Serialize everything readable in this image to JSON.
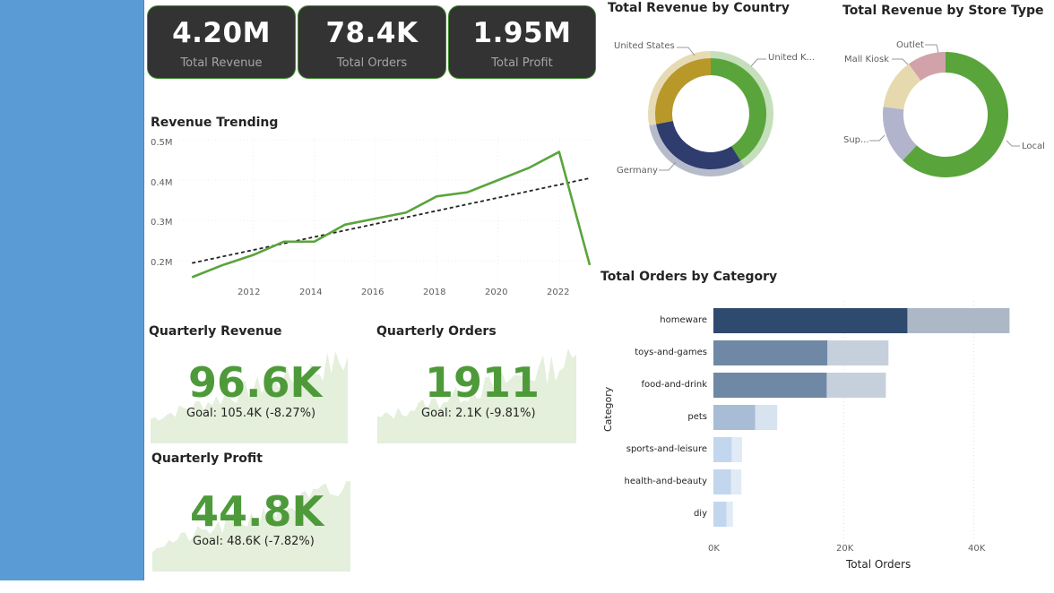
{
  "kpis": [
    {
      "value": "4.20M",
      "label": "Total Revenue"
    },
    {
      "value": "78.4K",
      "label": "Total Orders"
    },
    {
      "value": "1.95M",
      "label": "Total Profit"
    }
  ],
  "revenue_trend": {
    "title": "Revenue Trending",
    "y_ticks": [
      "0.5M",
      "0.4M",
      "0.3M",
      "0.2M"
    ],
    "x_ticks": [
      "2012",
      "2014",
      "2016",
      "2018",
      "2020",
      "2022"
    ]
  },
  "quarterly": [
    {
      "title": "Quarterly Revenue",
      "value": "96.6K",
      "goal": "Goal: 105.4K (-8.27%)"
    },
    {
      "title": "Quarterly Orders",
      "value": "1911",
      "goal": "Goal: 2.1K (-9.81%)"
    },
    {
      "title": "Quarterly Profit",
      "value": "44.8K",
      "goal": "Goal: 48.6K (-7.82%)"
    }
  ],
  "country_donut": {
    "title": "Total Revenue by Country",
    "labels": [
      "United States",
      "United K...",
      "Germany"
    ]
  },
  "store_donut": {
    "title": "Total Revenue by Store Type",
    "labels": [
      "Outlet",
      "Mall Kiosk",
      "Sup...",
      "Local"
    ]
  },
  "orders_chart": {
    "title": "Total Orders by Category",
    "ylabel": "Category",
    "xlabel": "Total Orders",
    "x_ticks": [
      "0K",
      "20K",
      "40K"
    ]
  },
  "colors": {
    "green": "#5aa43c",
    "navy": "#2e3c6e",
    "gold": "#b9982a",
    "kpi_bg": "#333333",
    "sidebar": "#5b9bd5"
  },
  "chart_data": [
    {
      "type": "line",
      "title": "Revenue Trending",
      "x": [
        2010,
        2011,
        2012,
        2013,
        2014,
        2015,
        2016,
        2017,
        2018,
        2019,
        2020,
        2021,
        2022,
        2023
      ],
      "series": [
        {
          "values": [
            0.16,
            0.19,
            0.215,
            0.248,
            0.248,
            0.29,
            0.305,
            0.32,
            0.36,
            0.37,
            0.4,
            0.43,
            0.47,
            0.19
          ]
        }
      ],
      "trend": [
        0.195,
        0.405
      ],
      "ylim": [
        0.15,
        0.5
      ],
      "xlim": [
        2009.7,
        2023.0
      ]
    },
    {
      "type": "pie",
      "title": "Total Revenue by Country",
      "categories": [
        "United Kingdom",
        "Germany",
        "United States"
      ],
      "values": [
        41,
        31,
        28
      ],
      "colors": [
        "#5aa43c",
        "#2e3c6e",
        "#b9982a"
      ]
    },
    {
      "type": "pie",
      "title": "Total Revenue by Store Type",
      "categories": [
        "Local",
        "Super Store",
        "Mall Kiosk",
        "Outlet"
      ],
      "values": [
        62,
        15,
        13,
        10
      ],
      "colors": [
        "#5aa43c",
        "#b1b4cc",
        "#e6d9ae",
        "#d2a2ab"
      ]
    },
    {
      "type": "bar",
      "title": "Total Orders by Category",
      "categories": [
        "homeware",
        "toys-and-games",
        "food-and-drink",
        "pets",
        "sports-and-leisure",
        "health-and-beauty",
        "diy"
      ],
      "series": [
        {
          "values": [
            29.8,
            17.5,
            17.4,
            6.4,
            2.8,
            2.7,
            2.0
          ]
        },
        {
          "values": [
            45.5,
            26.9,
            26.5,
            9.8,
            4.4,
            4.3,
            3.0
          ]
        }
      ],
      "xlabel": "Total Orders",
      "ylabel": "Category",
      "xlim": [
        0,
        46
      ]
    }
  ]
}
